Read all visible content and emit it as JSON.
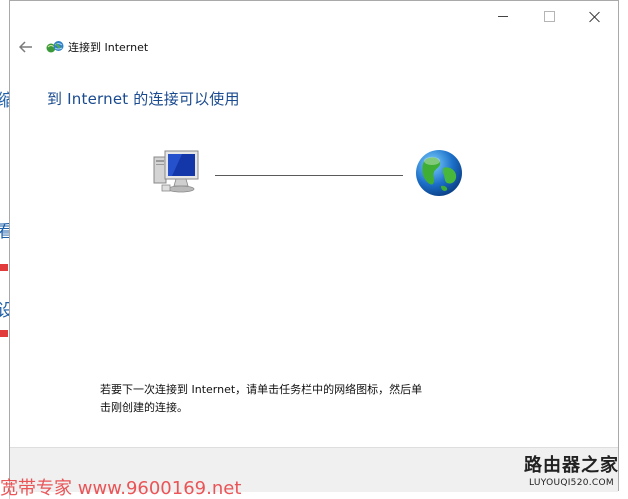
{
  "background_window": {
    "glyphs": [
      "缩",
      "看",
      "设"
    ]
  },
  "window": {
    "nav_title": "连接到 Internet",
    "heading": "到 Internet 的连接可以使用",
    "instruction_line1": "若要下一次连接到 Internet，请单击任务栏中的网络图标，然后单",
    "instruction_line2": "击刚创建的连接。",
    "icons": {
      "back": "back-arrow-icon",
      "network": "network-connection-icon",
      "computer": "computer-icon",
      "globe": "globe-icon",
      "minimize": "minimize-icon",
      "maximize": "maximize-icon",
      "close": "close-icon"
    }
  },
  "watermarks": {
    "left": "宽带专家 www.9600169.net",
    "right_title": "路由器之家",
    "right_url": "LUYOUQI520.COM"
  },
  "colors": {
    "heading": "#1a4a8f",
    "watermark_left": "#e8393d"
  }
}
